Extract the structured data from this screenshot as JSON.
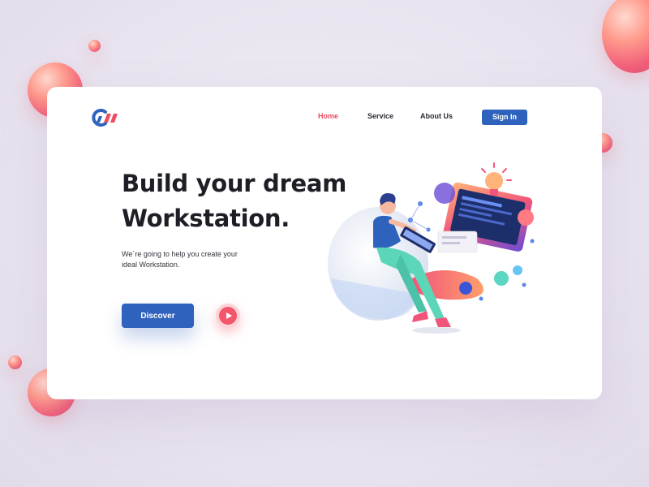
{
  "nav": {
    "items": [
      {
        "label": "Home",
        "active": true
      },
      {
        "label": "Service",
        "active": false
      },
      {
        "label": "About Us",
        "active": false
      }
    ],
    "signin_label": "Sign In"
  },
  "hero": {
    "headline_line1": "Build your dream",
    "headline_line2": "Workstation.",
    "subtext_line1": "We`re going to help you create your",
    "subtext_line2": "ideal Workstation.",
    "discover_label": "Discover"
  },
  "icons": {
    "logo": "brand-logo",
    "play": "play-icon",
    "illustration": "workstation-illustration"
  },
  "colors": {
    "primary": "#2f62bd",
    "accent": "#ee4c62",
    "text": "#1e1e27",
    "background": "#ece7f1",
    "card": "#ffffff"
  }
}
